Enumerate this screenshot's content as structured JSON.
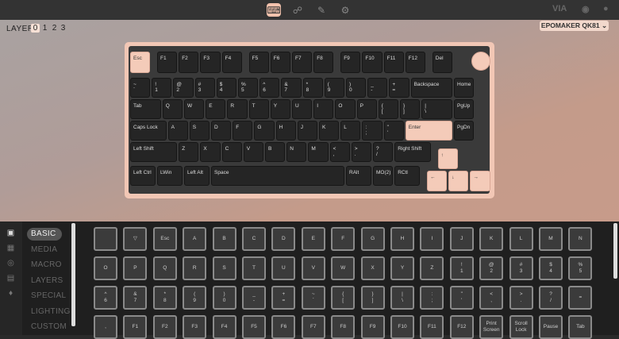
{
  "topbar": {
    "icons": [
      {
        "name": "keyboard-icon",
        "glyph": "⌨",
        "active": true
      },
      {
        "name": "plug-icon",
        "glyph": "☍",
        "active": false
      },
      {
        "name": "brush-icon",
        "glyph": "✎",
        "active": false
      },
      {
        "name": "gear-icon",
        "glyph": "⚙",
        "active": false
      }
    ],
    "right_label": "VIA"
  },
  "layer": {
    "label": "LAYER",
    "numbers": [
      "0",
      "1",
      "2",
      "3"
    ],
    "active": "0"
  },
  "keyboard_selector": "EPOMAKER QK81 ⌄",
  "keyboard": {
    "rows": [
      [
        "Esc",
        "F1",
        "F2",
        "F3",
        "F4",
        "F5",
        "F6",
        "F7",
        "F8",
        "F9",
        "F10",
        "F11",
        "F12",
        "Del"
      ],
      [
        "~\n`",
        "!\n1",
        "@\n2",
        "#\n3",
        "$\n4",
        "%\n5",
        "^\n6",
        "&\n7",
        "*\n8",
        "(\n9",
        ")\n0",
        "_\n-",
        "+\n=",
        "Backspace",
        "Home"
      ],
      [
        "Tab",
        "Q",
        "W",
        "E",
        "R",
        "T",
        "Y",
        "U",
        "I",
        "O",
        "P",
        "{\n[",
        "}\n]",
        "|\n\\",
        "PgUp"
      ],
      [
        "Caps Lock",
        "A",
        "S",
        "D",
        "F",
        "G",
        "H",
        "J",
        "K",
        "L",
        ":\n;",
        "\"\n'",
        "Enter",
        "PgDn"
      ],
      [
        "Left Shift",
        "Z",
        "X",
        "C",
        "V",
        "B",
        "N",
        "M",
        "<\n,",
        ">\n.",
        "?\n/",
        "Right Shift",
        "↑"
      ],
      [
        "Left Ctrl",
        "LWin",
        "Left Alt",
        "Space",
        "RAlt",
        "MO(2)",
        "RCtl",
        "←",
        "↓",
        "→"
      ]
    ]
  },
  "side_icons": [
    "keyboard-icon",
    "grid-icon",
    "target-icon",
    "save-icon",
    "bulb-icon"
  ],
  "menu": {
    "items": [
      "BASIC",
      "MEDIA",
      "MACRO",
      "LAYERS",
      "SPECIAL",
      "LIGHTING",
      "CUSTOM"
    ],
    "active": "BASIC"
  },
  "keycodes": {
    "rows": [
      [
        "",
        "▽",
        "Esc",
        "A",
        "B",
        "C",
        "D",
        "E",
        "F",
        "G",
        "H",
        "I",
        "J",
        "K",
        "L",
        "M",
        "N"
      ],
      [
        "O",
        "P",
        "Q",
        "R",
        "S",
        "T",
        "U",
        "V",
        "W",
        "X",
        "Y",
        "Z",
        "!\n1",
        "@\n2",
        "#\n3",
        "$\n4",
        "%\n5"
      ],
      [
        "^\n6",
        "&\n7",
        "*\n8",
        "(\n9",
        ")\n0",
        "_\n-",
        "+\n=",
        "~\n`",
        "{\n[",
        "}\n]",
        "|\n\\",
        ":\n;",
        "\"\n'",
        "<\n,",
        ">\n.",
        "?\n/",
        "="
      ],
      [
        ",",
        "F1",
        "F2",
        "F3",
        "F4",
        "F5",
        "F6",
        "F7",
        "F8",
        "F9",
        "F10",
        "F11",
        "F12",
        "Print\nScreen",
        "Scroll\nLock",
        "Pause",
        "Tab"
      ]
    ]
  },
  "colors": {
    "accent": "#f4cbb9",
    "case": "#f2c7b5",
    "key": "#252525"
  }
}
